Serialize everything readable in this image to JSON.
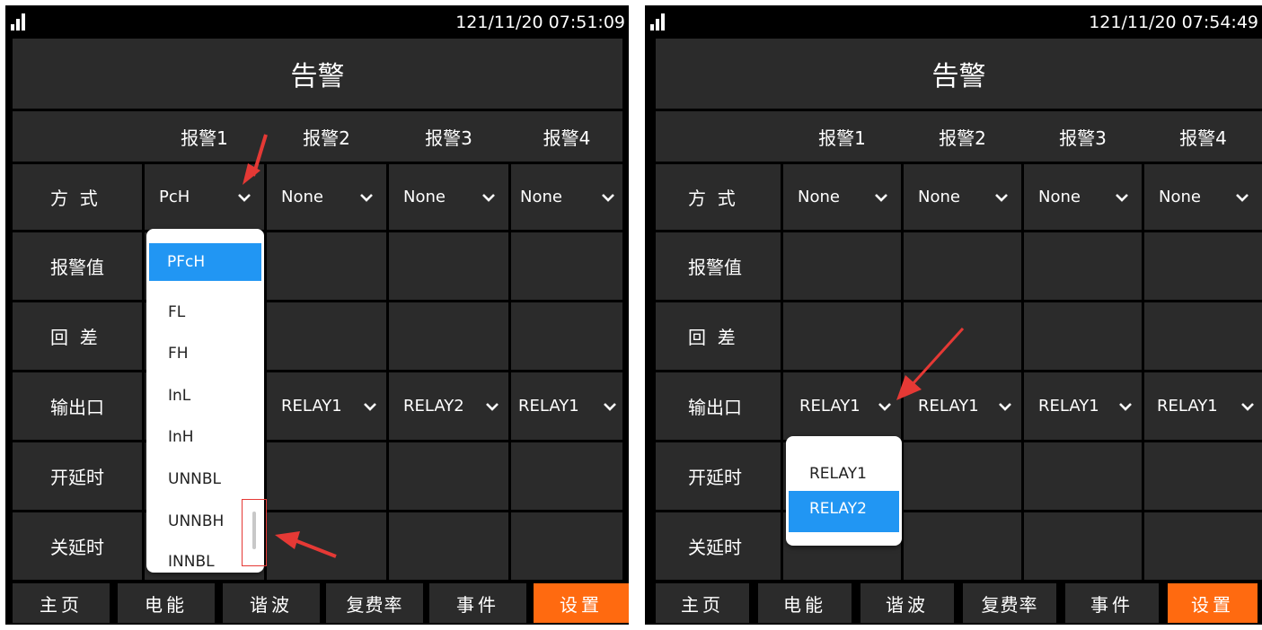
{
  "left": {
    "status": {
      "datetime": "121/11/20 07:51:09"
    },
    "title": "告警",
    "headers": [
      "报警1",
      "报警2",
      "报警3",
      "报警4"
    ],
    "rows": {
      "mode": {
        "label": "方  式",
        "values": [
          "PcH",
          "None",
          "None",
          "None"
        ]
      },
      "alarm_value": {
        "label": "报警值"
      },
      "hysteresis": {
        "label": "回  差"
      },
      "output": {
        "label": "输出口",
        "values": [
          "",
          "RELAY1",
          "RELAY2",
          "RELAY1"
        ]
      },
      "on_delay": {
        "label": "开延时"
      },
      "off_delay": {
        "label": "关延时"
      }
    },
    "dropdown": {
      "options": [
        "PFcH",
        "FL",
        "FH",
        "InL",
        "InH",
        "UNNBL",
        "UNNBH",
        "INNBL"
      ],
      "selected": "PFcH"
    },
    "nav": [
      "主页",
      "电能",
      "谐波",
      "复费率",
      "事件",
      "设置"
    ],
    "nav_active": "设置"
  },
  "right": {
    "status": {
      "datetime": "121/11/20 07:54:49"
    },
    "title": "告警",
    "headers": [
      "报警1",
      "报警2",
      "报警3",
      "报警4"
    ],
    "rows": {
      "mode": {
        "label": "方  式",
        "values": [
          "None",
          "None",
          "None",
          "None"
        ]
      },
      "alarm_value": {
        "label": "报警值"
      },
      "hysteresis": {
        "label": "回  差"
      },
      "output": {
        "label": "输出口",
        "values": [
          "RELAY1",
          "RELAY1",
          "RELAY1",
          "RELAY1"
        ]
      },
      "on_delay": {
        "label": "开延时"
      },
      "off_delay": {
        "label": "关延时"
      }
    },
    "dropdown": {
      "options": [
        "RELAY1",
        "RELAY2"
      ],
      "selected": "RELAY2"
    },
    "nav": [
      "主页",
      "电能",
      "谐波",
      "复费率",
      "事件",
      "设置"
    ],
    "nav_active": "设置"
  },
  "colors": {
    "background": "#000000",
    "cell": "#2b2b2b",
    "selected_option": "#2196f3",
    "active_nav": "#ff6a10",
    "annotation_arrow": "#e53935"
  }
}
